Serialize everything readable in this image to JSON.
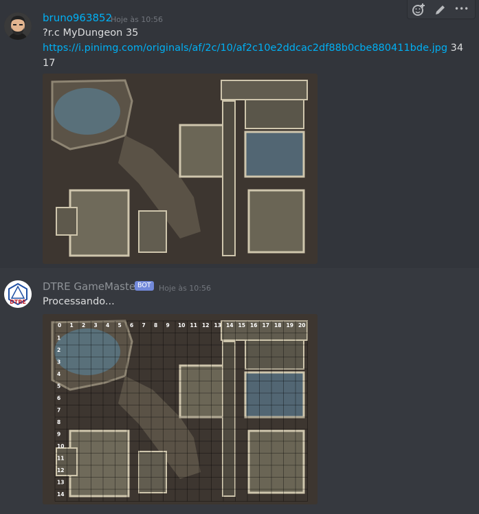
{
  "messages": [
    {
      "author": "bruno963852",
      "timestamp": "Hoje às 10:56",
      "command": "?r.c MyDungeon 35",
      "link": "https://i.pinimg.com/originals/af/2c/10/af2c10e2ddcac2df88b0cbe880411bde.jpg",
      "after_link": "34",
      "line3": "17"
    },
    {
      "author": "DTRE GameMaster",
      "bot_tag": "BOT",
      "timestamp": "Hoje às 10:56",
      "text": "Processando...",
      "avatar_text": "DTRE",
      "grid_cols": [
        "0",
        "1",
        "2",
        "3",
        "4",
        "5",
        "6",
        "7",
        "8",
        "9",
        "10",
        "11",
        "12",
        "13",
        "14",
        "15",
        "16",
        "17",
        "18",
        "19",
        "20"
      ],
      "grid_rows": [
        "1",
        "2",
        "3",
        "4",
        "5",
        "6",
        "7",
        "8",
        "9",
        "10",
        "11",
        "12",
        "13",
        "14"
      ]
    }
  ],
  "toolbar": {
    "icons": [
      "add-reaction-icon",
      "edit-icon",
      "more-icon"
    ],
    "more_label": "•••"
  },
  "colors": {
    "background": "#36393f",
    "hover": "#32353b",
    "link": "#00b0f4",
    "user_name": "#00b0f4",
    "bot_name": "#8e9297",
    "bot_tag": "#7289da"
  }
}
